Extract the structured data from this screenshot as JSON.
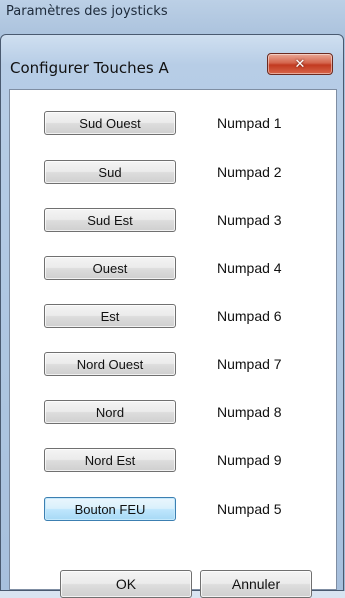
{
  "parent_window": {
    "title": "Paramètres des joysticks"
  },
  "dialog": {
    "title": "Configurer Touches A",
    "close_icon": "close-icon",
    "close_glyph": "✕"
  },
  "bindings": [
    {
      "direction": "Sud Ouest",
      "key": "Numpad 1"
    },
    {
      "direction": "Sud",
      "key": "Numpad 2"
    },
    {
      "direction": "Sud Est",
      "key": "Numpad 3"
    },
    {
      "direction": "Ouest",
      "key": "Numpad 4"
    },
    {
      "direction": "Est",
      "key": "Numpad 6"
    },
    {
      "direction": "Nord Ouest",
      "key": "Numpad 7"
    },
    {
      "direction": "Nord",
      "key": "Numpad 8"
    },
    {
      "direction": "Nord Est",
      "key": "Numpad 9"
    },
    {
      "direction": "Bouton FEU",
      "key": "Numpad 5"
    }
  ],
  "footer": {
    "ok_label": "OK",
    "cancel_label": "Annuler"
  },
  "colors": {
    "close_button": "#c23a20",
    "focused_button_border": "#3c7fb1",
    "client_background": "#ffffff"
  }
}
